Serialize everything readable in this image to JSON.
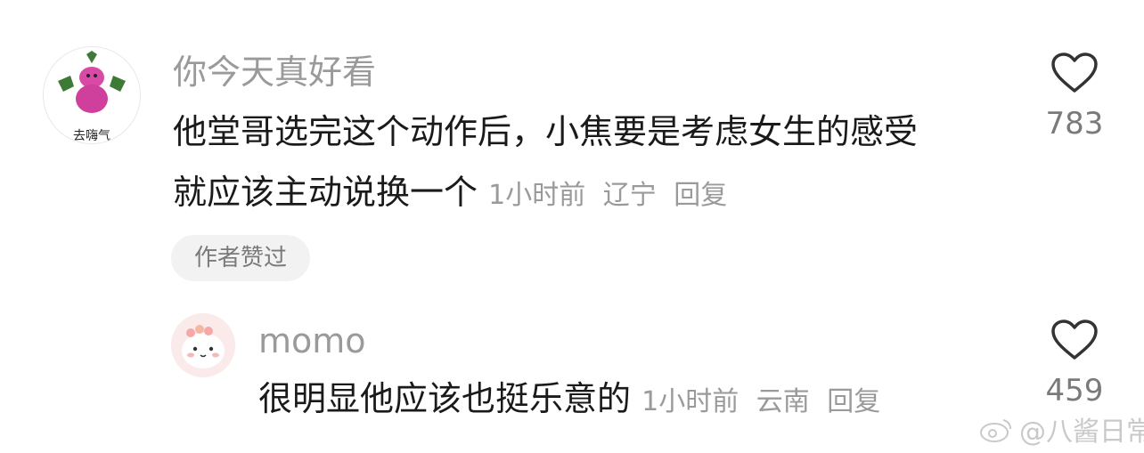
{
  "comment1": {
    "avatar_text": "去嗨气",
    "username": "你今天真好看",
    "text_line1": "他堂哥选完这个动作后，小焦要是考虑女生的感受",
    "text_line2": "就应该主动说换一个",
    "time": "1小时前",
    "location": "辽宁",
    "reply_label": "回复",
    "likes": "783",
    "author_liked_badge": "作者赞过"
  },
  "reply1": {
    "username": "momo",
    "text": "很明显他应该也挺乐意的",
    "time": "1小时前",
    "location": "云南",
    "reply_label": "回复",
    "likes": "459"
  },
  "watermark": {
    "text": "@八酱日常"
  },
  "colors": {
    "secondary_text": "#9a9a9a",
    "primary_text": "#1a1a1a",
    "badge_bg": "#f2f2f2"
  }
}
